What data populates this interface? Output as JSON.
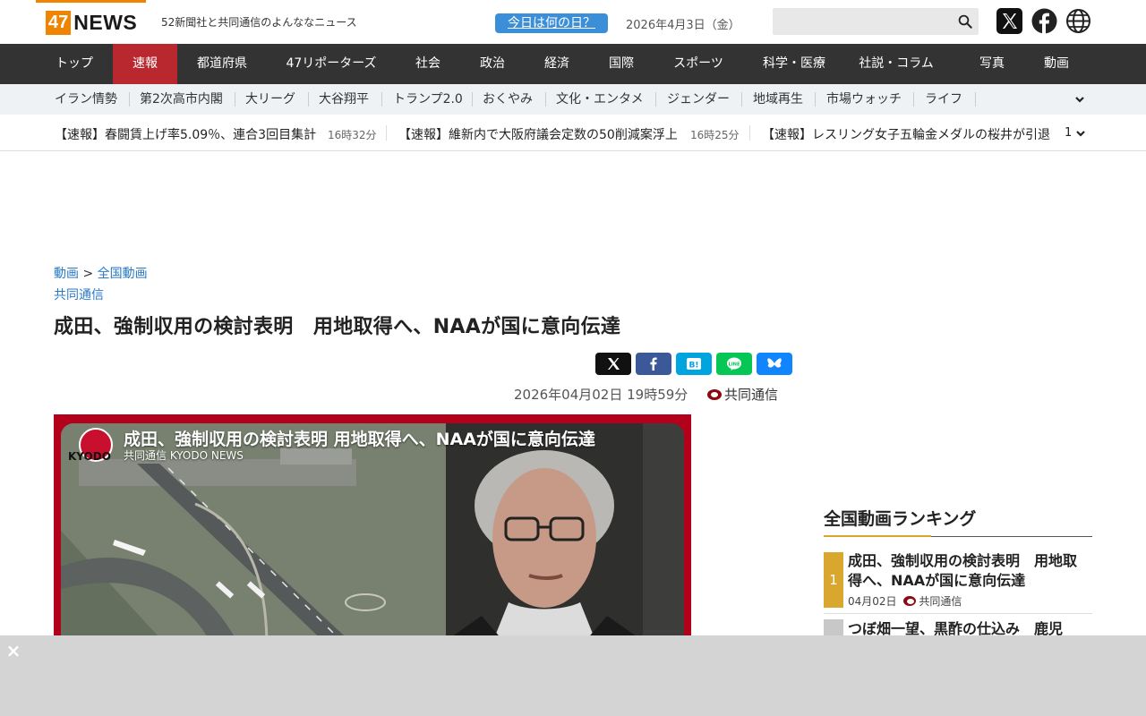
{
  "header": {
    "logo_number": "47",
    "logo_word": "NEWS",
    "tagline": "52新聞社と共同通信のよんななニュース",
    "today_button": "今日は何の日？",
    "date": "2026年4月3日（金）",
    "search_placeholder": ""
  },
  "main_nav": [
    {
      "label": "トップ"
    },
    {
      "label": "速報"
    },
    {
      "label": "都道府県"
    },
    {
      "label": "47リポーターズ"
    },
    {
      "label": "社会"
    },
    {
      "label": "政治"
    },
    {
      "label": "経済"
    },
    {
      "label": "国際"
    },
    {
      "label": "スポーツ"
    },
    {
      "label": "科学・医療"
    },
    {
      "label": "社説・コラム"
    },
    {
      "label": "写真"
    },
    {
      "label": "動画"
    }
  ],
  "sub_nav": [
    {
      "label": "イラン情勢"
    },
    {
      "label": "第2次高市内閣"
    },
    {
      "label": "大リーグ"
    },
    {
      "label": "大谷翔平"
    },
    {
      "label": "トランプ2.0"
    },
    {
      "label": "おくやみ"
    },
    {
      "label": "文化・エンタメ"
    },
    {
      "label": "ジェンダー"
    },
    {
      "label": "地域再生"
    },
    {
      "label": "市場ウォッチ"
    },
    {
      "label": "ライフ"
    }
  ],
  "ticker": {
    "items": [
      {
        "title": "【速報】春闘賃上げ率5.09％、連合3回目集計",
        "time": "16時32分"
      },
      {
        "title": "【速報】維新内で大阪府議会定数の50削減案浮上",
        "time": "16時25分"
      },
      {
        "title": "【速報】レスリング女子五輪金メダルの桜井が引退",
        "time": ""
      }
    ],
    "count": "1"
  },
  "article": {
    "breadcrumb_home": "動画",
    "breadcrumb_sep": ">",
    "breadcrumb_current": "全国動画",
    "source_link": "共同通信",
    "title": "成田、強制収用の検討表明　用地取得へ、NAAが国に意向伝達",
    "datetime": "2026年04月02日 19時59分",
    "source": "共同通信",
    "share_buttons": [
      "x",
      "facebook",
      "hatena",
      "line",
      "bluesky"
    ]
  },
  "video": {
    "title": "成田、強制収用の検討表明 用地取得へ、NAAが国に意向伝達",
    "subtitle": "共同通信 KYODO NEWS",
    "logo_text": "KYODO"
  },
  "ranking": {
    "heading": "全国動画ランキング",
    "items": [
      {
        "rank": "1",
        "title": "成田、強制収用の検討表明　用地取得へ、NAAが国に意向伝達",
        "date": "04月02日",
        "source": "共同通信"
      },
      {
        "rank": "",
        "title": "つぼ畑一望、黒酢の仕込み　鹿児",
        "date": "",
        "source": ""
      }
    ]
  },
  "ad_overlay": {
    "close_label": "×"
  },
  "colors": {
    "brand_orange": "#f08300",
    "nav_bg": "#333333",
    "nav_active": "#b9282e",
    "link_blue": "#2a7ac7",
    "rank_gold": "#d9a72e",
    "video_frame_red": "#b3001b"
  }
}
